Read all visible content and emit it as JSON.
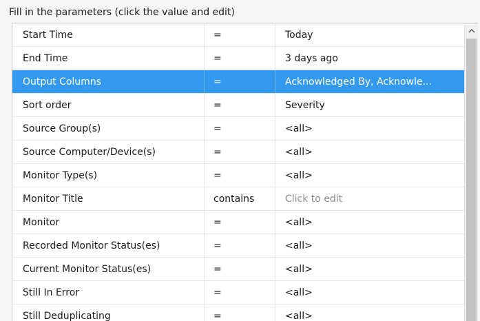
{
  "caption": "Fill in the parameters (click the value and edit)",
  "selected_row_index": 2,
  "colors": {
    "selection": "#3399ee",
    "placeholder": "#8e8e8e"
  },
  "rows": [
    {
      "name": "Start Time",
      "operator": "=",
      "value": "Today",
      "is_placeholder": false
    },
    {
      "name": "End Time",
      "operator": "=",
      "value": "3 days ago",
      "is_placeholder": false
    },
    {
      "name": "Output Columns",
      "operator": "=",
      "value": "Acknowledged By, Acknowle...",
      "is_placeholder": false
    },
    {
      "name": "Sort order",
      "operator": "=",
      "value": "Severity",
      "is_placeholder": false
    },
    {
      "name": "Source Group(s)",
      "operator": "=",
      "value": "<all>",
      "is_placeholder": false
    },
    {
      "name": "Source Computer/Device(s)",
      "operator": "=",
      "value": "<all>",
      "is_placeholder": false
    },
    {
      "name": "Monitor Type(s)",
      "operator": "=",
      "value": "<all>",
      "is_placeholder": false
    },
    {
      "name": "Monitor Title",
      "operator": "contains",
      "value": "Click to edit",
      "is_placeholder": true
    },
    {
      "name": "Monitor",
      "operator": "=",
      "value": "<all>",
      "is_placeholder": false
    },
    {
      "name": "Recorded Monitor Status(es)",
      "operator": "=",
      "value": "<all>",
      "is_placeholder": false
    },
    {
      "name": "Current Monitor Status(es)",
      "operator": "=",
      "value": "<all>",
      "is_placeholder": false
    },
    {
      "name": "Still In Error",
      "operator": "=",
      "value": "<all>",
      "is_placeholder": false
    },
    {
      "name": "Still Deduplicating",
      "operator": "=",
      "value": "<all>",
      "is_placeholder": false
    }
  ],
  "scrollbar": {
    "up_icon": "chevron-up-icon"
  }
}
